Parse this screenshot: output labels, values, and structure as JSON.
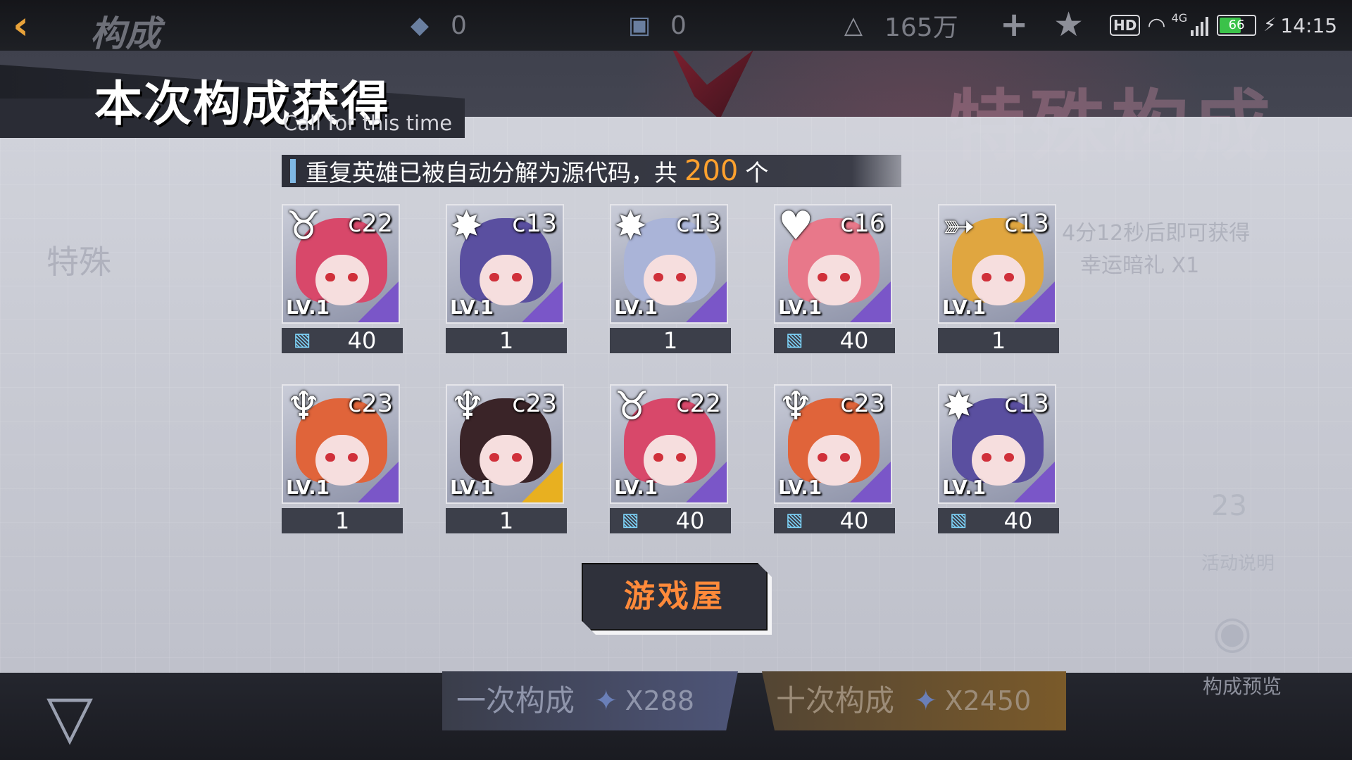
{
  "topbar": {
    "back_icon": "back-arrow-icon",
    "title": "构成",
    "resources": [
      {
        "icon": "crystal-icon",
        "value": "0"
      },
      {
        "icon": "cube-icon",
        "value": "0"
      },
      {
        "icon": "triangle-emblem-icon",
        "value": "165万"
      }
    ],
    "plus_icon": "plus-icon",
    "rank_icon": "star-emblem-icon"
  },
  "status_bar": {
    "hd": "HD",
    "network": "4G",
    "battery": "66",
    "time": "14:15"
  },
  "background": {
    "banner_text": "特殊构成",
    "side_text": "特殊",
    "timer_text": "4分12秒后即可获得",
    "lucky_text": "幸运暗礼 X1",
    "event_info": "活动说明",
    "calendar_day": "23"
  },
  "result": {
    "title": "本次构成获得",
    "subtitle": "Call for this time",
    "notice_prefix": "重复英雄已被自动分解为源代码，共",
    "notice_count": "200",
    "notice_suffix": "个"
  },
  "heroes": [
    {
      "class_icon": "demon-horns-icon",
      "code": "c22",
      "level": "LV.1",
      "count": "40",
      "chip": true,
      "rarity_color": "#7a56c8",
      "hair": "#d8486a"
    },
    {
      "class_icon": "shuriken-icon",
      "code": "c13",
      "level": "LV.1",
      "count": "1",
      "chip": false,
      "rarity_color": "#7a56c8",
      "hair": "#5a4fa0"
    },
    {
      "class_icon": "shuriken-icon",
      "code": "c13",
      "level": "LV.1",
      "count": "1",
      "chip": false,
      "rarity_color": "#7a56c8",
      "hair": "#aab4d8"
    },
    {
      "class_icon": "heart-wings-icon",
      "code": "c16",
      "level": "LV.1",
      "count": "40",
      "chip": true,
      "rarity_color": "#7a56c8",
      "hair": "#e8788a"
    },
    {
      "class_icon": "bow-arrow-icon",
      "code": "c13",
      "level": "LV.1",
      "count": "1",
      "chip": false,
      "rarity_color": "#7a56c8",
      "hair": "#e0a640"
    },
    {
      "class_icon": "trident-icon",
      "code": "c23",
      "level": "LV.1",
      "count": "1",
      "chip": false,
      "rarity_color": "#7a56c8",
      "hair": "#e0643a"
    },
    {
      "class_icon": "trident-icon",
      "code": "c23",
      "level": "LV.1",
      "count": "1",
      "chip": false,
      "rarity_color": "#e8b020",
      "hair": "#3a2428"
    },
    {
      "class_icon": "demon-horns-icon",
      "code": "c22",
      "level": "LV.1",
      "count": "40",
      "chip": true,
      "rarity_color": "#7a56c8",
      "hair": "#d8486a"
    },
    {
      "class_icon": "trident-icon",
      "code": "c23",
      "level": "LV.1",
      "count": "40",
      "chip": true,
      "rarity_color": "#7a56c8",
      "hair": "#e0643a"
    },
    {
      "class_icon": "shuriken-icon",
      "code": "c13",
      "level": "LV.1",
      "count": "40",
      "chip": true,
      "rarity_color": "#7a56c8",
      "hair": "#5a4fa0"
    }
  ],
  "game_house_button": "游戏屋",
  "bottom": {
    "once_label": "一次构成",
    "once_cost": "X288",
    "ten_label": "十次构成",
    "ten_cost": "X2450",
    "preview_label": "构成预览"
  }
}
